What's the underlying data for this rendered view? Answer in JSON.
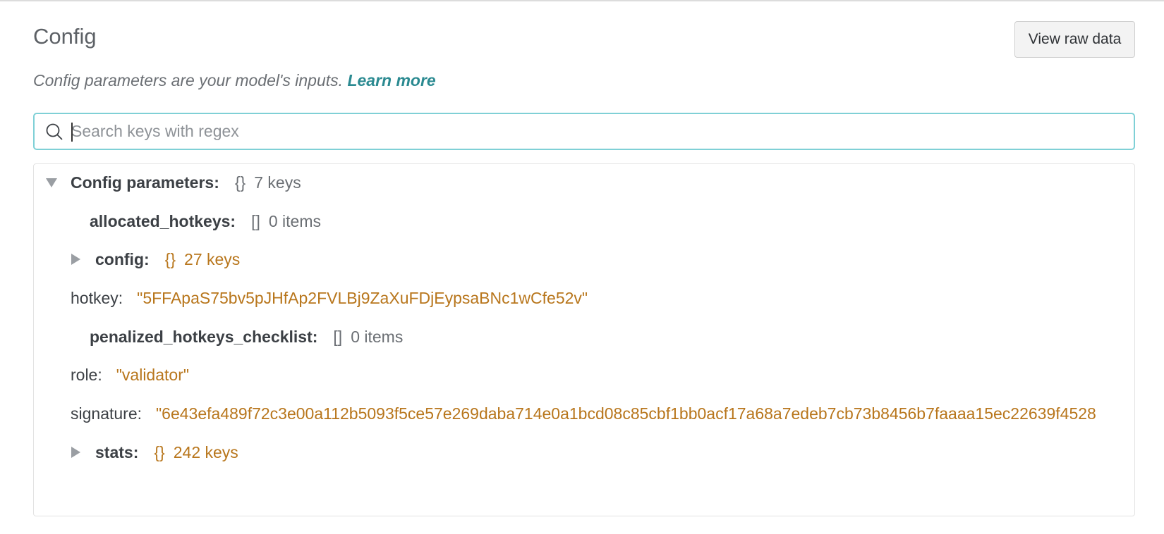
{
  "header": {
    "title": "Config",
    "raw_button_label": "View raw data"
  },
  "subtitle": {
    "text": "Config parameters are your model's inputs.",
    "link_label": "Learn more"
  },
  "search": {
    "placeholder": "Search keys with regex",
    "value": ""
  },
  "tree": {
    "root": {
      "label": "Config parameters:",
      "brace": "{}",
      "count": "7 keys",
      "expanded": true
    },
    "items": [
      {
        "key": "allocated_hotkeys:",
        "brace": "[]",
        "count": "0 items"
      },
      {
        "key": "config:",
        "brace": "{}",
        "count": "27 keys"
      },
      {
        "key": "hotkey:",
        "value": "\"5FFApaS75bv5pJHfAp2FVLBj9ZaXuFDjEypsaBNc1wCfe52v\""
      },
      {
        "key": "penalized_hotkeys_checklist:",
        "brace": "[]",
        "count": "0 items"
      },
      {
        "key": "role:",
        "value": "\"validator\""
      },
      {
        "key": "signature:",
        "value": "\"6e43efa489f72c3e00a112b5093f5ce57e269daba714e0a1bcd08c85cbf1bb0acf17a68a7edeb7cb73b8456b7faaaa15ec22639f4528"
      },
      {
        "key": "stats:",
        "brace": "{}",
        "count": "242 keys"
      }
    ]
  },
  "colors": {
    "accent": "#2b8a91",
    "search_border": "#7fd0d6",
    "value_orange": "#b8761c",
    "text": "#3c4045",
    "muted": "#6b6f74"
  },
  "icons": {
    "search": "search-icon",
    "expanded": "caret-down-icon",
    "collapsed": "caret-right-icon"
  }
}
